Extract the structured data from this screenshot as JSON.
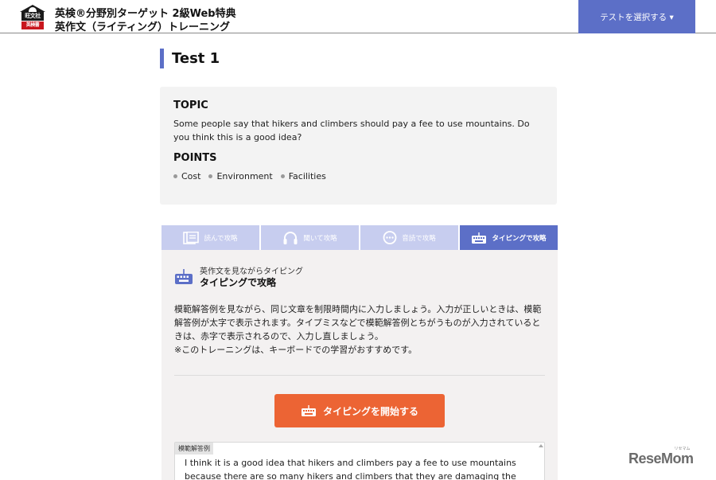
{
  "header": {
    "logo_top": "旺文社",
    "logo_bottom": "英検書",
    "title_line1": "英検®分野別ターゲット 2級Web特典",
    "title_line2": "英作文（ライティング）トレーニング",
    "select_label": "テストを選択する ▾"
  },
  "page": {
    "title": "Test 1"
  },
  "topic": {
    "heading": "TOPIC",
    "text": "Some people say that hikers and climbers should pay a fee to use mountains. Do you think this is a good idea?",
    "points_heading": "POINTS",
    "points": [
      "Cost",
      "Environment",
      "Facilities"
    ]
  },
  "tabs": [
    {
      "label": "読んで攻略",
      "icon": "book-icon",
      "active": false
    },
    {
      "label": "聞いて攻略",
      "icon": "headphones-icon",
      "active": false
    },
    {
      "label": "音読で攻略",
      "icon": "speech-bubble-icon",
      "active": false
    },
    {
      "label": "タイピングで攻略",
      "icon": "keyboard-icon",
      "active": true
    }
  ],
  "panel": {
    "sub_small": "英作文を見ながらタイピング",
    "sub_title": "タイピングで攻略",
    "desc": "模範解答例を見ながら、同じ文章を制限時間内に入力しましょう。入力が正しいときは、模範解答例が太字で表示されます。タイプミスなどで模範解答例とちがうものが入力されているときは、赤字で表示されるので、入力し直しましょう。\n※このトレーニングは、キーボードでの学習がおすすめです。",
    "start_button": "タイピングを開始する",
    "model_label": "模範解答例",
    "model_text": "I think it is a good idea that hikers and climbers pay a fee to use mountains because there are so many hikers and climbers that they are damaging the"
  },
  "watermark": {
    "text": "ReseMom",
    "ruby": "リセマム"
  },
  "colors": {
    "accent": "#5c6fc7",
    "accent_light": "#c7cdef",
    "button": "#ec6434",
    "panel_bg": "#f3f1f1"
  }
}
